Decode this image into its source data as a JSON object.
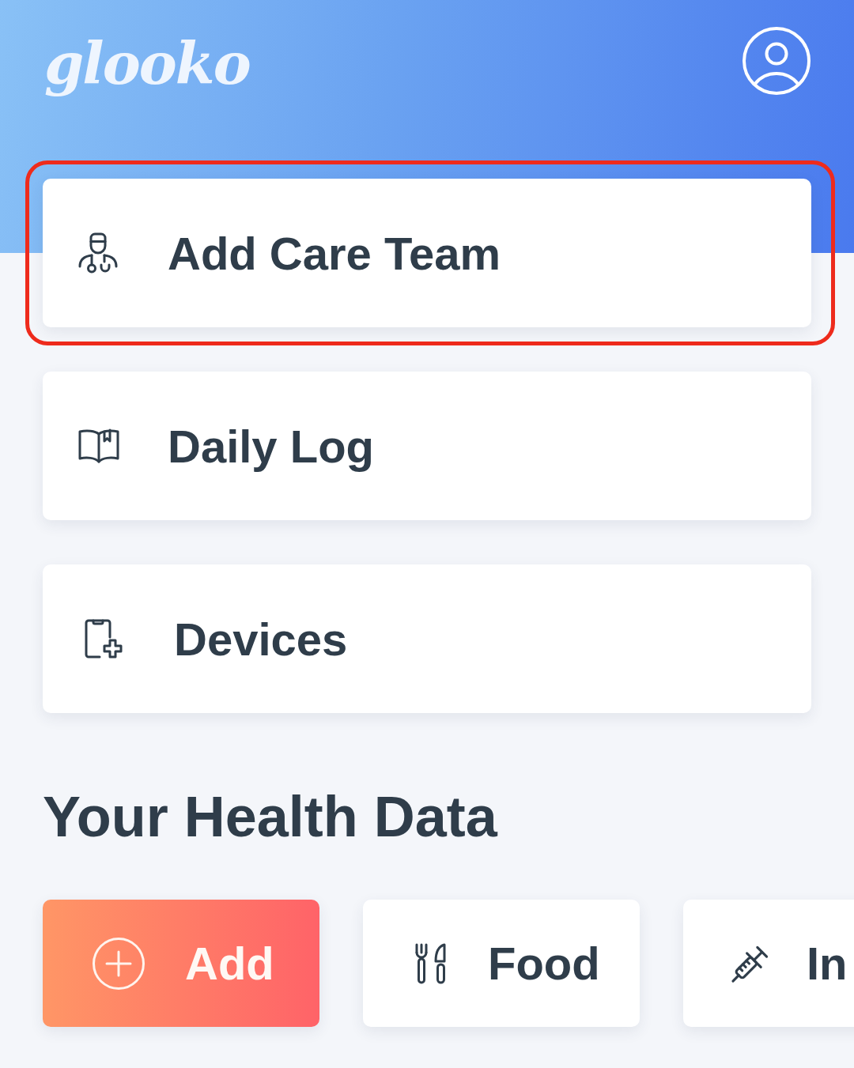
{
  "header": {
    "logo": "glooko"
  },
  "menu": [
    {
      "label": "Add Care Team",
      "highlighted": true
    },
    {
      "label": "Daily Log",
      "highlighted": false
    },
    {
      "label": "Devices",
      "highlighted": false
    }
  ],
  "health_data": {
    "title": "Your Health Data",
    "tiles": [
      {
        "kind": "add",
        "label": "Add"
      },
      {
        "kind": "category",
        "label": "Food"
      },
      {
        "kind": "category",
        "label": "In"
      }
    ]
  }
}
